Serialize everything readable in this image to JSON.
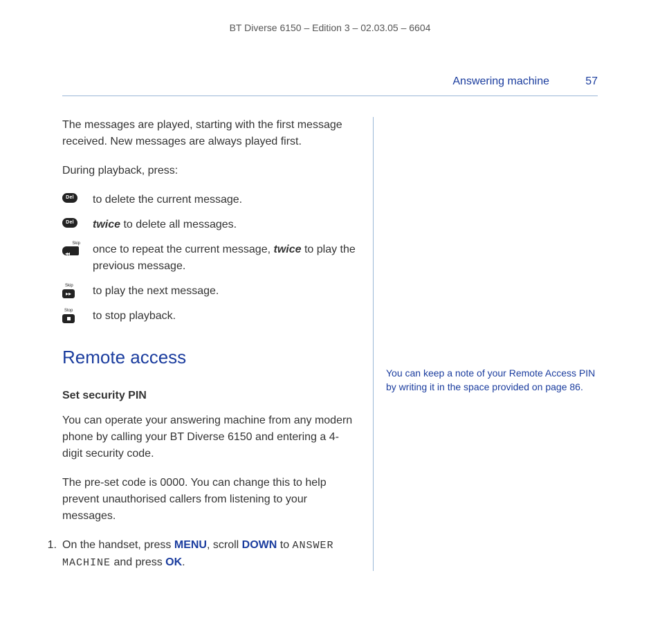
{
  "header": {
    "doc_id": "BT Diverse 6150 – Edition 3 – 02.03.05 – 6604"
  },
  "section": {
    "name": "Answering machine",
    "page_number": "57"
  },
  "main": {
    "intro1": "The messages are played, starting with the first message received. New messages are always played first.",
    "intro2": "During playback, press:",
    "rows": {
      "del1": "to delete the current message.",
      "del2_emph": "twice",
      "del2_rest": " to delete all messages.",
      "skipback_a": "once to repeat the current message, ",
      "skipback_emph": "twice",
      "skipback_b": " to play the previous message.",
      "skipfwd": "to play the next message.",
      "stop": "to stop playback."
    },
    "h2": "Remote access",
    "h3": "Set security PIN",
    "p1": "You can operate your answering machine from any modern phone by calling your BT Diverse 6150 and entering a 4-digit security code.",
    "p2": "The pre-set code is 0000. You can change this to help prevent unauthorised callers from listening to your messages.",
    "step1": {
      "num": "1.",
      "a": "On the handset, press ",
      "kw1": "MENU",
      "b": ", scroll ",
      "kw2": "DOWN",
      "c": " to ",
      "lcd": "ANSWER MACHINE",
      "d": " and press ",
      "kw3": "OK",
      "e": "."
    }
  },
  "side": {
    "note": "You can keep a note of your Remote Access PIN by writing it in the space provided on page 86."
  },
  "icons": {
    "del": "Del",
    "skip": "Skip",
    "skip_fwd": "Skip",
    "stop": "Stop"
  }
}
